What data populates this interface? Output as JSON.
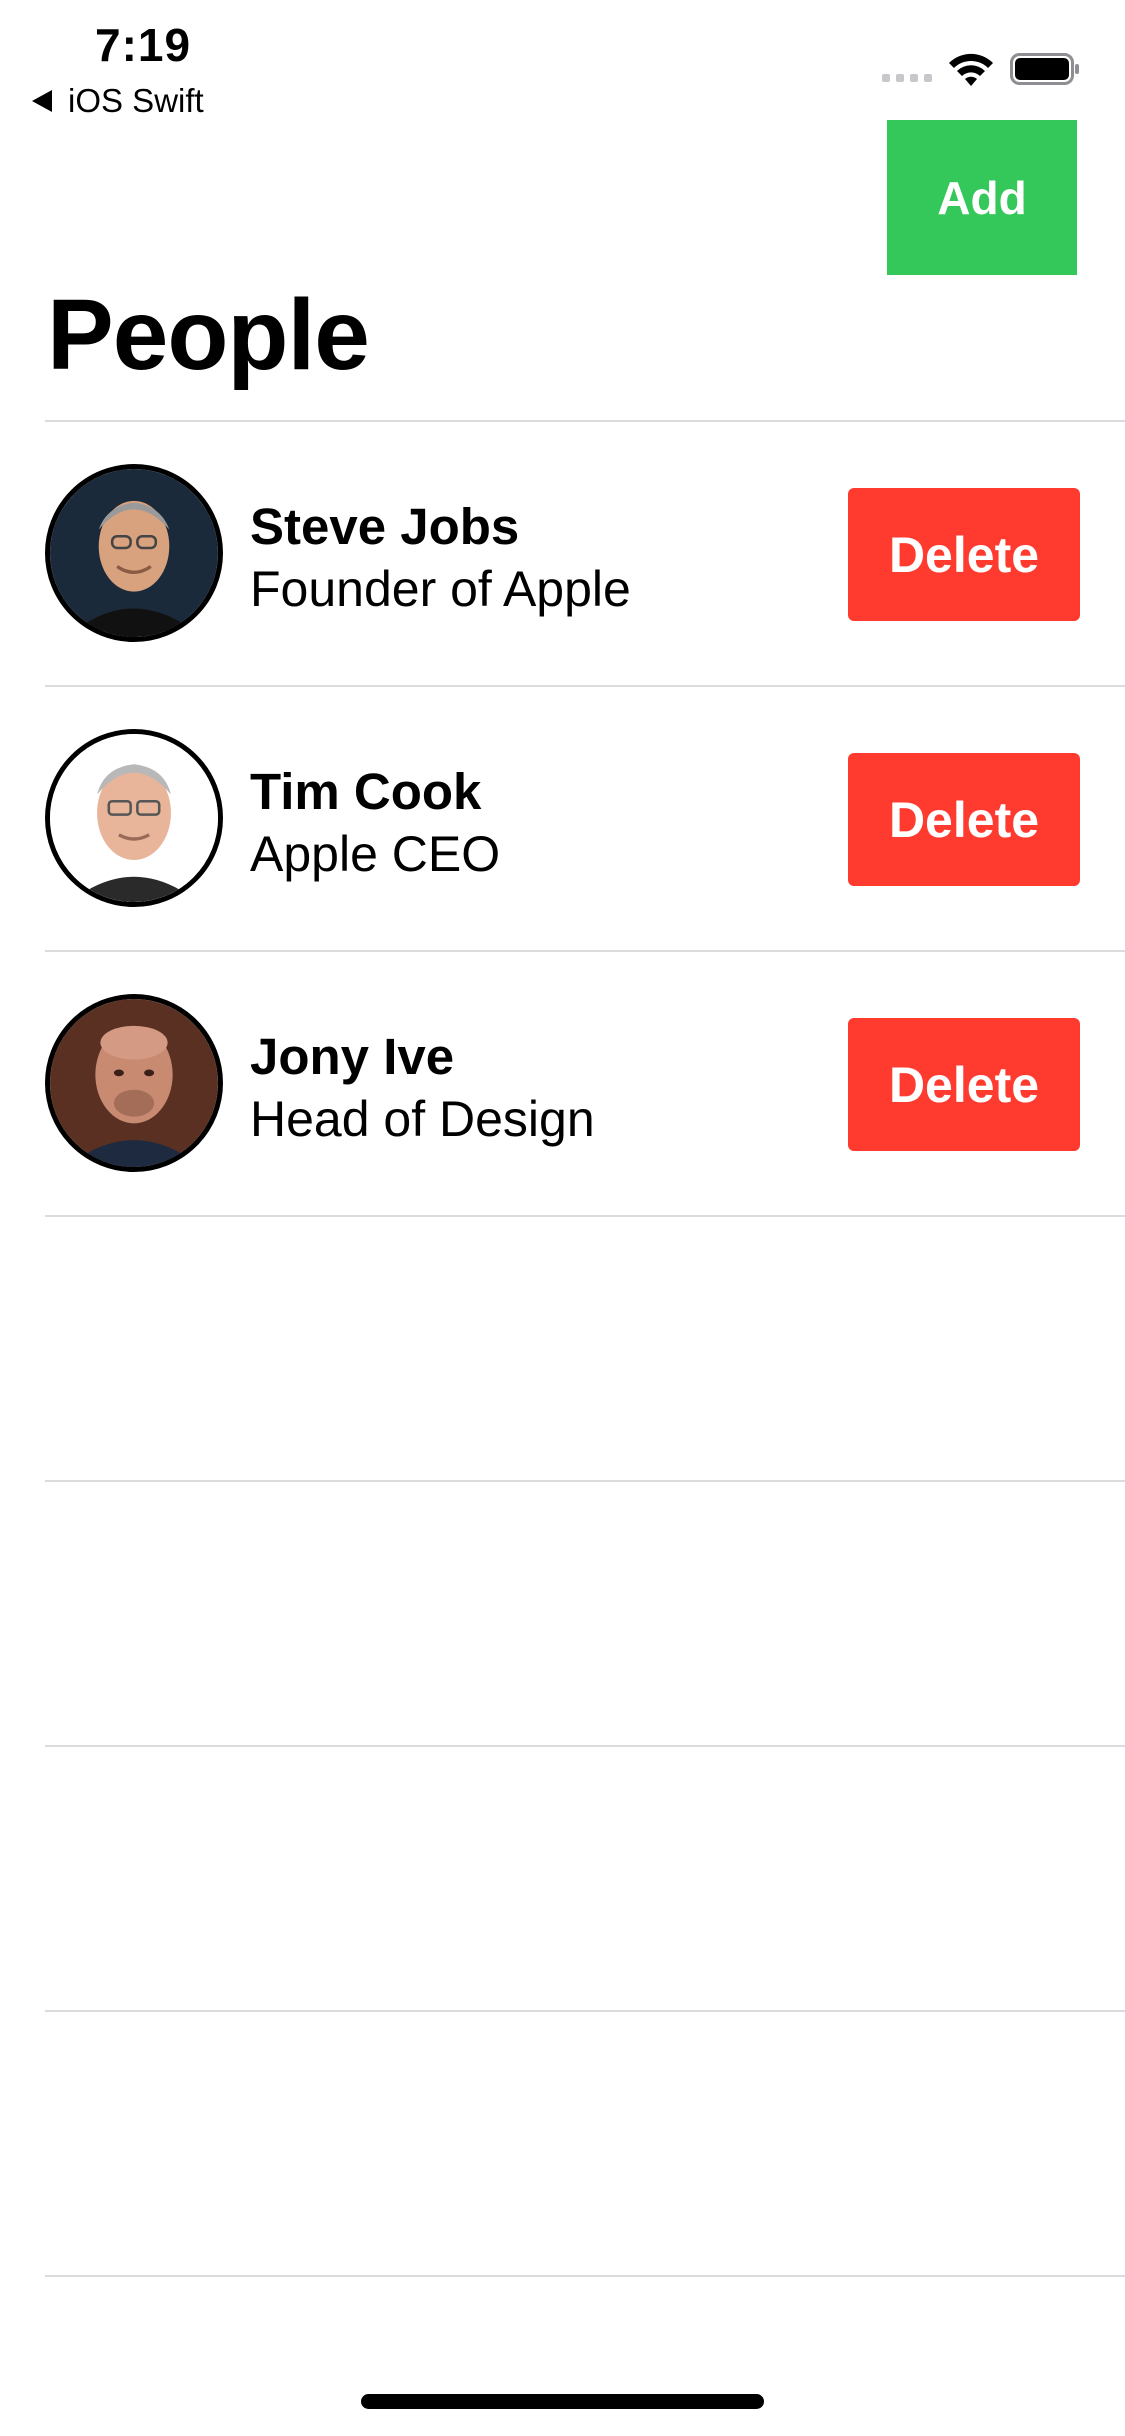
{
  "status_bar": {
    "time": "7:19",
    "back_app": "iOS Swift"
  },
  "nav": {
    "add_label": "Add",
    "title": "People"
  },
  "people": [
    {
      "name": "Steve Jobs",
      "role": "Founder of Apple",
      "delete_label": "Delete",
      "avatar_bg": "#1b2a3a",
      "avatar_skin": "#d9a27e"
    },
    {
      "name": "Tim Cook",
      "role": "Apple CEO",
      "delete_label": "Delete",
      "avatar_bg": "#ffffff",
      "avatar_skin": "#e8b49a"
    },
    {
      "name": "Jony Ive",
      "role": "Head of Design",
      "delete_label": "Delete",
      "avatar_bg": "#5a3022",
      "avatar_skin": "#c98a72"
    }
  ],
  "colors": {
    "add_button": "#34c759",
    "delete_button": "#ff3b30",
    "separator": "#dcdcdf"
  }
}
